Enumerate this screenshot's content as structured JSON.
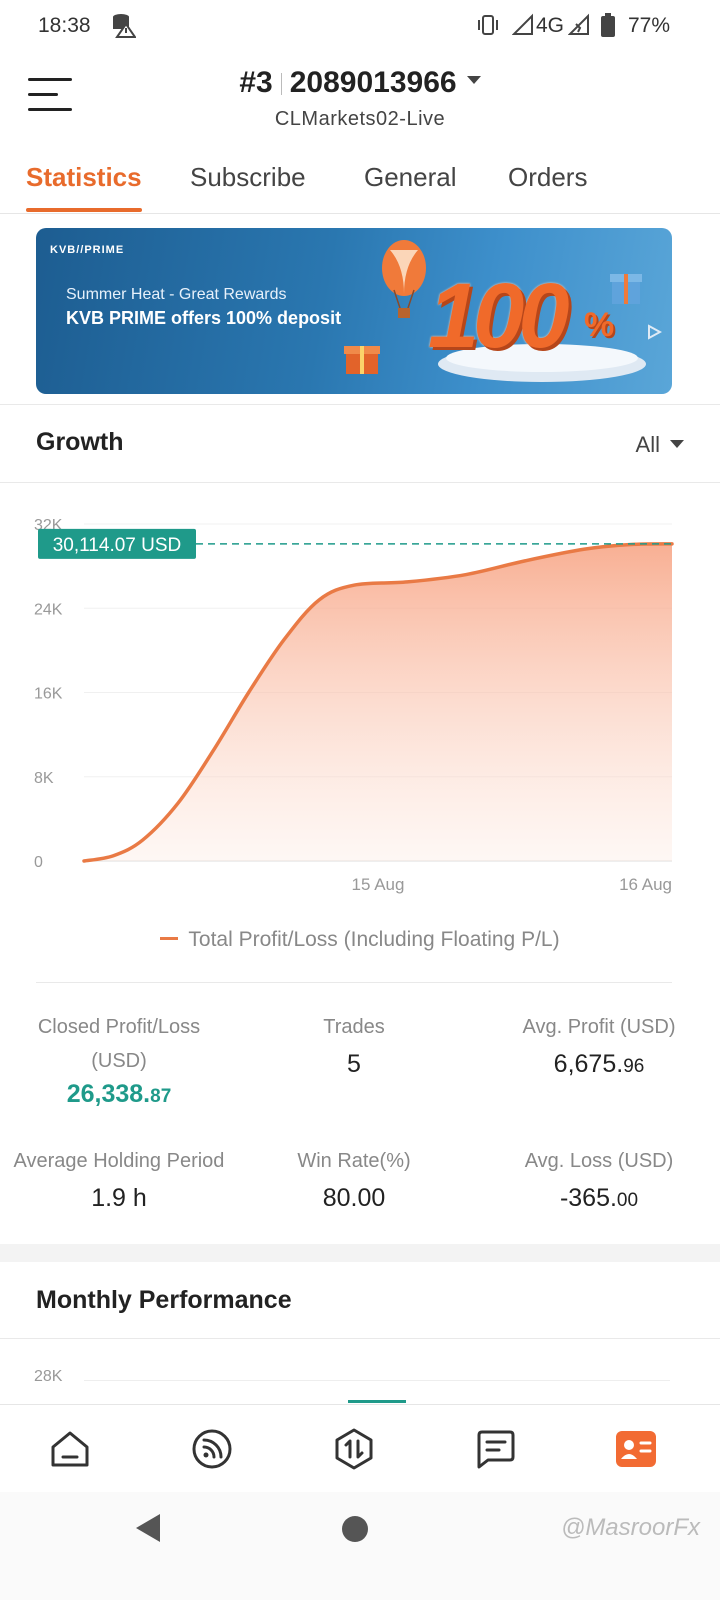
{
  "status_bar": {
    "time": "18:38",
    "network": "4G",
    "battery": "77%"
  },
  "header": {
    "account_prefix": "#3",
    "account_number": "2089013966",
    "server": "CLMarkets02-Live"
  },
  "tabs": [
    {
      "label": "Statistics",
      "active": true
    },
    {
      "label": "Subscribe",
      "active": false
    },
    {
      "label": "General",
      "active": false
    },
    {
      "label": "Orders",
      "active": false
    }
  ],
  "banner": {
    "brand": "KVB//PRIME",
    "line1": "Summer Heat - Great Rewards",
    "line2": "KVB PRIME offers 100% deposit",
    "big_number": "100",
    "big_suffix": "%"
  },
  "growth": {
    "title": "Growth",
    "range": "All"
  },
  "chart_data": {
    "type": "area",
    "y_ticks": [
      "0",
      "8K",
      "16K",
      "24K",
      "32K"
    ],
    "ylim": [
      0,
      32000
    ],
    "x_ticks": [
      "15 Aug",
      "16 Aug"
    ],
    "current_value_label": "30,114.07 USD",
    "current_value": 30114.07,
    "series": [
      {
        "name": "Total Profit/Loss (Including Floating P/L)",
        "color": "#e97a45",
        "points": [
          {
            "t": 0.0,
            "y": 0
          },
          {
            "t": 0.05,
            "y": 500
          },
          {
            "t": 0.1,
            "y": 2000
          },
          {
            "t": 0.16,
            "y": 5500
          },
          {
            "t": 0.22,
            "y": 10500
          },
          {
            "t": 0.28,
            "y": 16000
          },
          {
            "t": 0.34,
            "y": 21000
          },
          {
            "t": 0.4,
            "y": 24800
          },
          {
            "t": 0.46,
            "y": 26200
          },
          {
            "t": 0.55,
            "y": 26500
          },
          {
            "t": 0.65,
            "y": 27200
          },
          {
            "t": 0.75,
            "y": 28500
          },
          {
            "t": 0.85,
            "y": 29600
          },
          {
            "t": 0.93,
            "y": 30050
          },
          {
            "t": 1.0,
            "y": 30114.07
          }
        ]
      }
    ],
    "grid": true,
    "legend_position": "bottom-center"
  },
  "stats": {
    "closed_pl_label": "Closed Profit/Loss",
    "closed_pl_unit": "(USD)",
    "closed_pl_int": "26,338.",
    "closed_pl_dec": "87",
    "trades_label": "Trades",
    "trades_value": "5",
    "avg_profit_label": "Avg. Profit (USD)",
    "avg_profit_int": "6,675.",
    "avg_profit_dec": "96",
    "avg_hold_label": "Average Holding Period",
    "avg_hold_value": "1.9 h",
    "win_rate_label": "Win Rate(%)",
    "win_rate_value": "80.00",
    "avg_loss_label": "Avg. Loss (USD)",
    "avg_loss_int": "-365.",
    "avg_loss_dec": "00"
  },
  "monthly": {
    "title": "Monthly Performance",
    "y_top_tick": "28K"
  },
  "bottom_nav": [
    {
      "icon": "home-icon",
      "active": false
    },
    {
      "icon": "signals-icon",
      "active": false
    },
    {
      "icon": "trade-icon",
      "active": false
    },
    {
      "icon": "messages-icon",
      "active": false
    },
    {
      "icon": "profile-card-icon",
      "active": true
    }
  ],
  "watermark": "@MasroorFx",
  "colors": {
    "accent": "#e86b2c",
    "positive": "#1f9a8a",
    "chart_line": "#e97a45"
  }
}
